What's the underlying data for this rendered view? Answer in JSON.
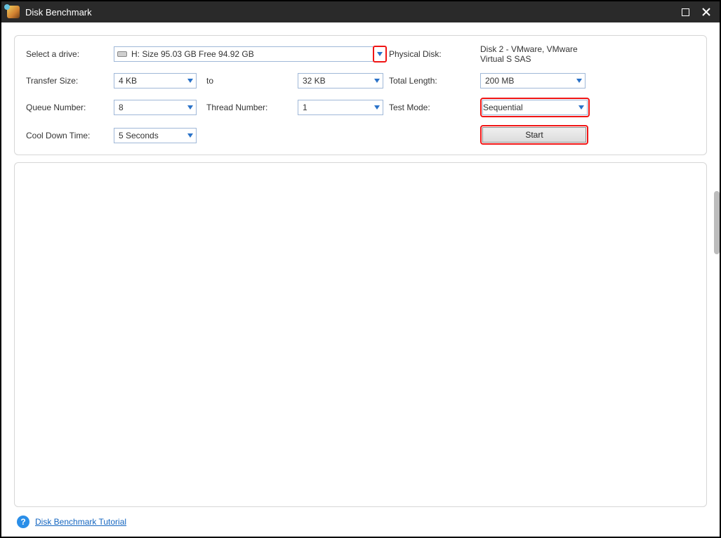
{
  "titlebar": {
    "title": "Disk Benchmark"
  },
  "settings": {
    "drive_label": "Select a drive:",
    "drive_value": "H:  Size 95.03 GB  Free 94.92 GB",
    "physical_disk_label": "Physical Disk:",
    "physical_disk_value": "Disk 2 - VMware, VMware Virtual S SAS",
    "transfer_size_label": "Transfer Size:",
    "transfer_size_from": "4 KB",
    "transfer_size_to_word": "to",
    "transfer_size_to": "32 KB",
    "total_length_label": "Total Length:",
    "total_length_value": "200 MB",
    "queue_number_label": "Queue Number:",
    "queue_number_value": "8",
    "thread_number_label": "Thread Number:",
    "thread_number_value": "1",
    "test_mode_label": "Test Mode:",
    "test_mode_value": "Sequential",
    "cool_down_label": "Cool Down Time:",
    "cool_down_value": "5 Seconds",
    "start_button": "Start"
  },
  "footer": {
    "tutorial_link": "Disk Benchmark Tutorial"
  }
}
